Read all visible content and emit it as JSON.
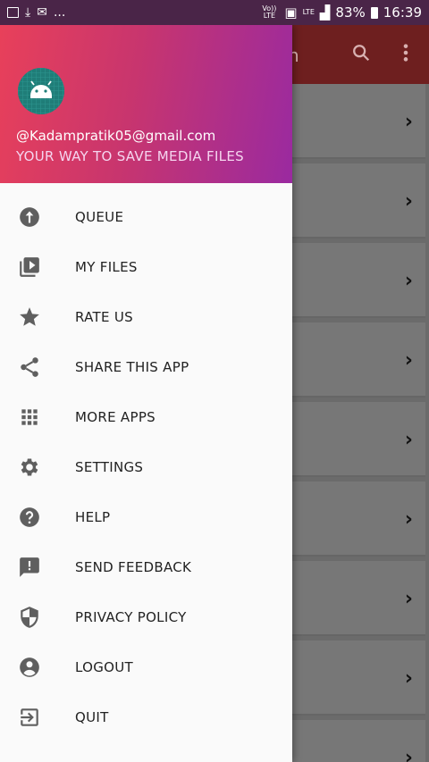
{
  "status_bar": {
    "volte": "Vo)) LTE",
    "lte": "LTE",
    "battery": "83%",
    "time": "16:39",
    "dots": "..."
  },
  "drawer": {
    "email": "@Kadampratik05@gmail.com",
    "tagline": "YOUR WAY TO SAVE MEDIA FILES",
    "items": [
      {
        "label": "QUEUE",
        "icon": "upload-circle-icon"
      },
      {
        "label": "MY FILES",
        "icon": "video-library-icon"
      },
      {
        "label": "RATE US",
        "icon": "star-icon"
      },
      {
        "label": "SHARE THIS APP",
        "icon": "share-icon"
      },
      {
        "label": "MORE APPS",
        "icon": "apps-grid-icon"
      },
      {
        "label": "SETTINGS",
        "icon": "gear-icon"
      },
      {
        "label": "HELP",
        "icon": "help-icon"
      },
      {
        "label": "SEND FEEDBACK",
        "icon": "feedback-icon"
      },
      {
        "label": "PRIVACY POLICY",
        "icon": "shield-icon"
      },
      {
        "label": "LOGOUT",
        "icon": "account-circle-icon"
      },
      {
        "label": "QUIT",
        "icon": "exit-icon"
      }
    ]
  },
  "background": {
    "partial_title": "n",
    "chevron": "›"
  }
}
